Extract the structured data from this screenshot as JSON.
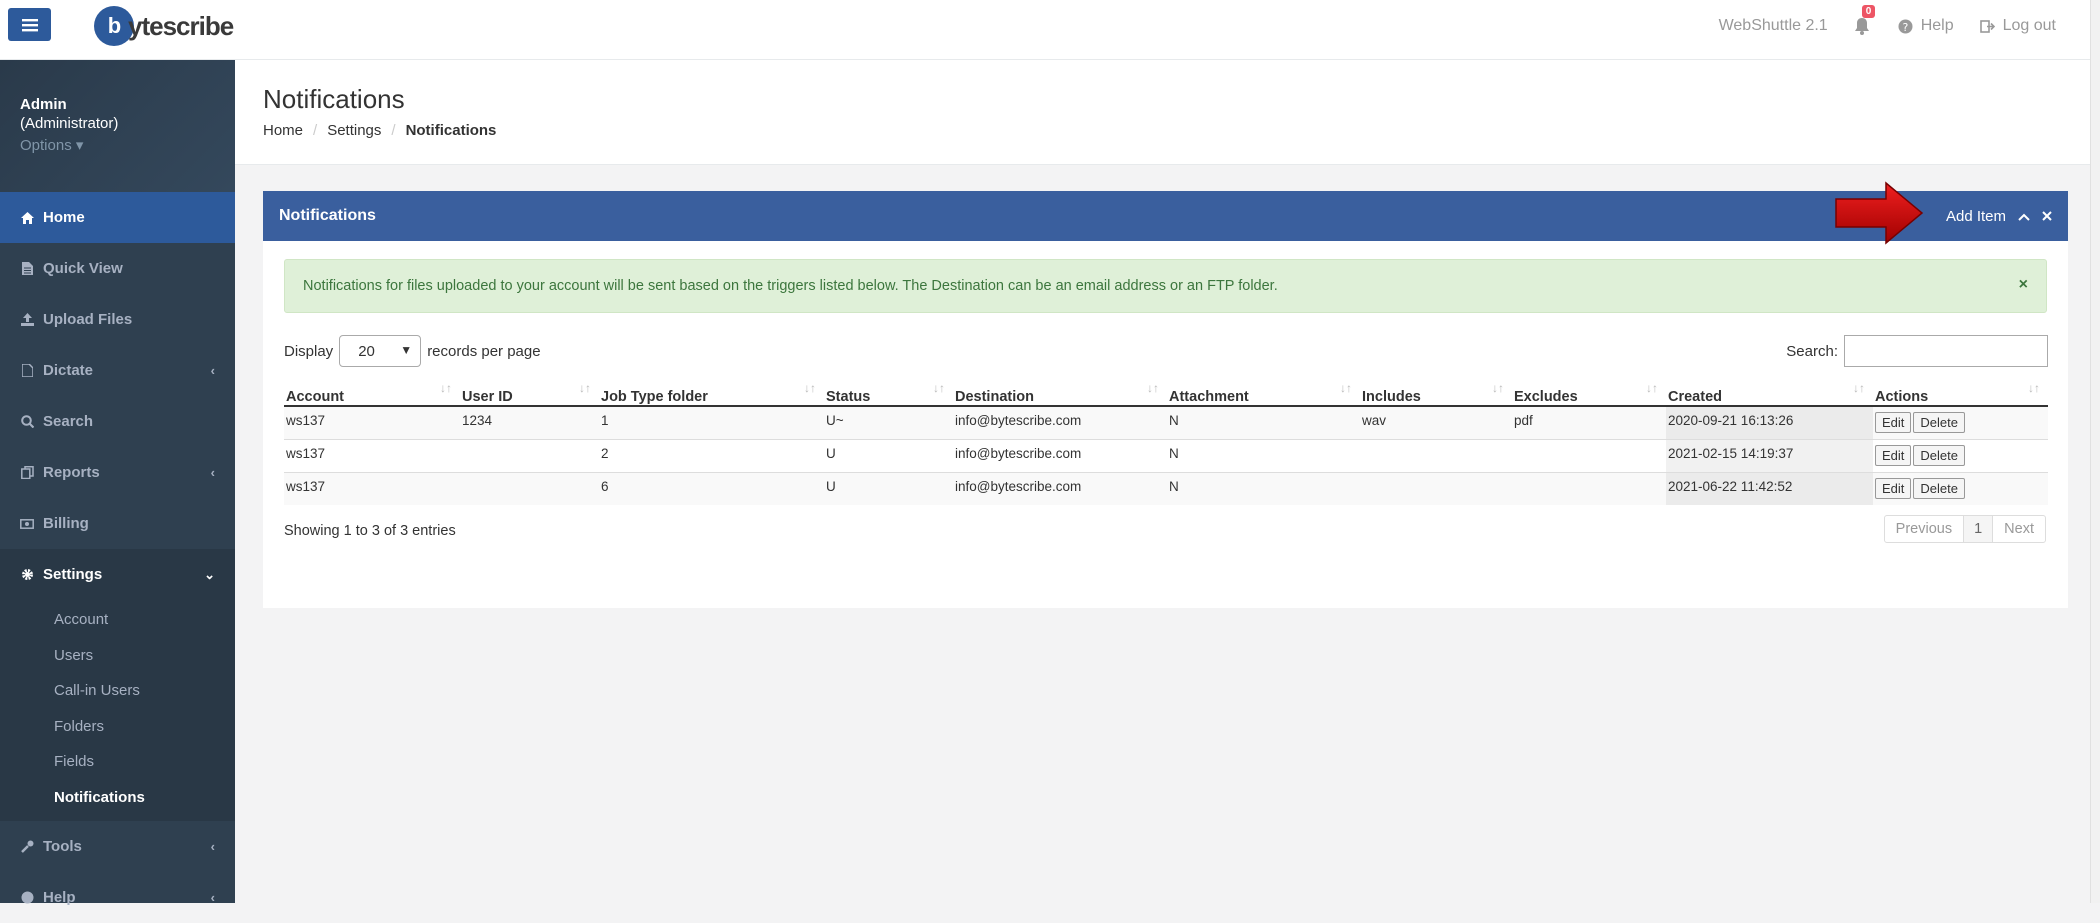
{
  "app": {
    "version": "WebShuttle 2.1",
    "notif_count": "0",
    "help": "Help",
    "logout": "Log out",
    "logo_mark": "b",
    "logo_text": "ytescribe"
  },
  "profile": {
    "name": "Admin",
    "role": "(Administrator)",
    "options": "Options ▾"
  },
  "nav": {
    "home": "Home",
    "quick_view": "Quick View",
    "upload": "Upload Files",
    "dictate": "Dictate",
    "search": "Search",
    "reports": "Reports",
    "billing": "Billing",
    "settings": "Settings",
    "tools": "Tools",
    "help": "Help"
  },
  "settings_sub": [
    "Account",
    "Users",
    "Call-in Users",
    "Folders",
    "Fields",
    "Notifications"
  ],
  "page": {
    "title": "Notifications",
    "crumbs": [
      "Home",
      "Settings",
      "Notifications"
    ]
  },
  "panel": {
    "title": "Notifications",
    "add_item": "Add Item"
  },
  "alert": "Notifications for files uploaded to your account will be sent based on the triggers listed below. The Destination can be an email address or an FTP folder.",
  "controls": {
    "display": "Display",
    "page_size": "20",
    "per_page": "records per page",
    "search_label": "Search:"
  },
  "table": {
    "headers": [
      "Account",
      "User ID",
      "Job Type folder",
      "Status",
      "Destination",
      "Attachment",
      "Includes",
      "Excludes",
      "Created",
      "Actions"
    ],
    "rows": [
      [
        "ws137",
        "1234",
        "1",
        "U~",
        "info@bytescribe.com",
        "N",
        "wav",
        "pdf",
        "2020-09-21 16:13:26"
      ],
      [
        "ws137",
        "",
        "2",
        "U",
        "info@bytescribe.com",
        "N",
        "",
        "",
        "2021-02-15 14:19:37"
      ],
      [
        "ws137",
        "",
        "6",
        "U",
        "info@bytescribe.com",
        "N",
        "",
        "",
        "2021-06-22 11:42:52"
      ]
    ],
    "edit": "Edit",
    "delete": "Delete"
  },
  "footer": {
    "info": "Showing 1 to 3 of 3 entries",
    "prev": "Previous",
    "page": "1",
    "next": "Next"
  }
}
